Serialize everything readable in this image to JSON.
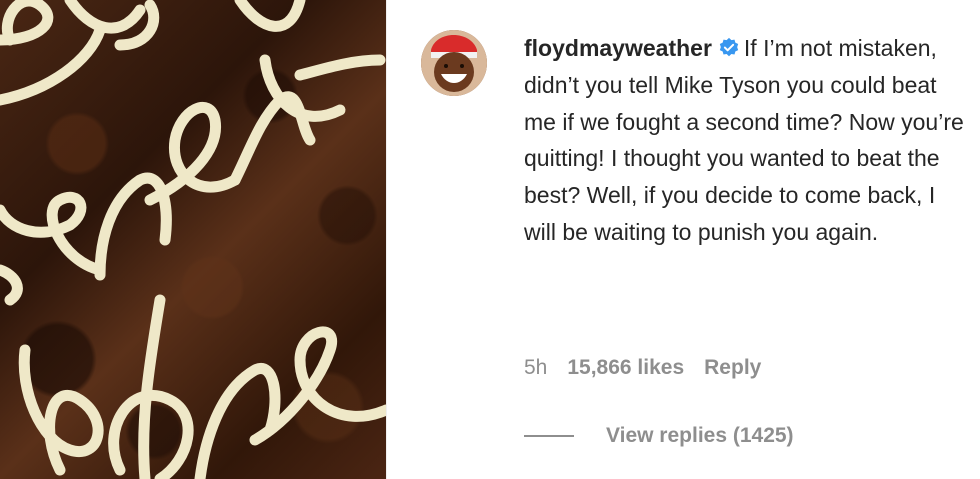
{
  "post": {
    "image": {
      "subject": "brownie-with-icing-writing"
    }
  },
  "comment": {
    "username": "floydmayweather",
    "verified": true,
    "text": "If I’m not mistaken, didn’t you tell Mike Tyson you could beat me if we fought a second time? Now you’re quitting! I thought you wanted to beat the best? Well, if you decide to come back, I will be waiting to punish you again.",
    "time": "5h",
    "likes": "15,866 likes",
    "reply_label": "Reply",
    "view_replies": "View replies (1425)"
  },
  "colors": {
    "text": "#262626",
    "muted": "#8e8e8e",
    "verified_badge": "#3897f0"
  },
  "icons": [
    "verified-badge-icon",
    "replies-line-icon"
  ]
}
